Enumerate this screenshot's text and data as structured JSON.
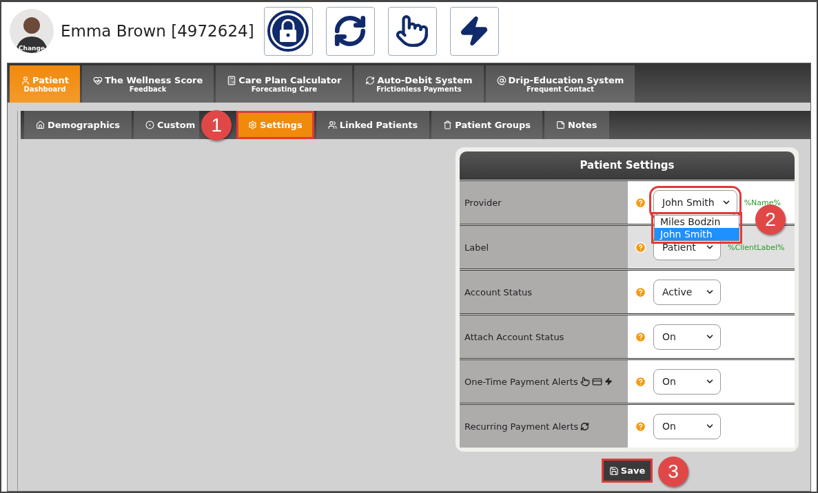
{
  "patient": {
    "name": "Emma Brown [4972624]",
    "avatar_label": "Change"
  },
  "main_tabs": [
    {
      "label": "Patient",
      "sublabel": "Dashboard",
      "selected": true
    },
    {
      "label": "The Wellness Score",
      "sublabel": "Feedback",
      "selected": false
    },
    {
      "label": "Care Plan Calculator",
      "sublabel": "Forecasting Care",
      "selected": false
    },
    {
      "label": "Auto-Debit System",
      "sublabel": "Frictionless Payments",
      "selected": false
    },
    {
      "label": "Drip-Education System",
      "sublabel": "Frequent Contact",
      "selected": false
    }
  ],
  "sub_tabs": [
    {
      "label": "Demographics",
      "selected": false,
      "outlined": false
    },
    {
      "label": "Custom",
      "selected": false,
      "outlined": false,
      "callout": "1"
    },
    {
      "label": "Settings",
      "selected": true,
      "outlined": true
    },
    {
      "label": "Linked Patients",
      "selected": false,
      "outlined": false
    },
    {
      "label": "Patient Groups",
      "selected": false,
      "outlined": false
    },
    {
      "label": "Notes",
      "selected": false,
      "outlined": false
    }
  ],
  "settings": {
    "title": "Patient Settings",
    "rows": [
      {
        "kind": "plain",
        "label": "Provider",
        "value": "John Smith",
        "tag": "%Name%",
        "highlighted": false,
        "expanded": true,
        "outlined": true,
        "callout": "2",
        "options": [
          {
            "label": "Miles Bodzin",
            "selected": false
          },
          {
            "label": "John Smith",
            "selected": true
          }
        ]
      },
      {
        "kind": "plain",
        "label": "Label",
        "value": "Patient",
        "tag": "%ClientLabel%",
        "highlighted": true
      },
      {
        "kind": "plain",
        "label": "Account Status",
        "value": "Active",
        "highlighted": false
      },
      {
        "kind": "plain",
        "label": "Attach Account Status",
        "value": "On",
        "highlighted": false
      },
      {
        "kind": "onetime",
        "label": "One-Time Payment Alerts",
        "value": "On",
        "highlighted": false
      },
      {
        "kind": "recurring",
        "label": "Recurring Payment Alerts",
        "value": "On",
        "highlighted": false
      }
    ]
  },
  "save_button": {
    "label": "Save",
    "outlined": true,
    "callout": "3"
  }
}
